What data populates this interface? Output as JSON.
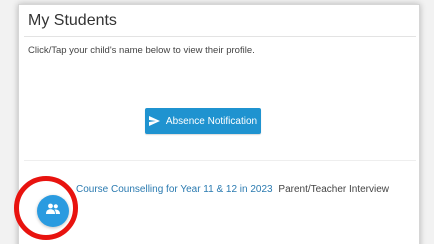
{
  "page": {
    "title": "My Students",
    "instructions": "Click/Tap your child's name below to view their profile."
  },
  "absence_button": {
    "label": "Absence Notification",
    "icon": "send-icon"
  },
  "event": {
    "link_text": "Course Counselling for Year 11 & 12 in 2023",
    "type_text": "Parent/Teacher Interview"
  },
  "fab": {
    "icon": "people-icon"
  },
  "colors": {
    "accent": "#1f93d0",
    "link": "#2a7ab0",
    "fab": "#2a9be0",
    "highlight": "#e8130f"
  }
}
